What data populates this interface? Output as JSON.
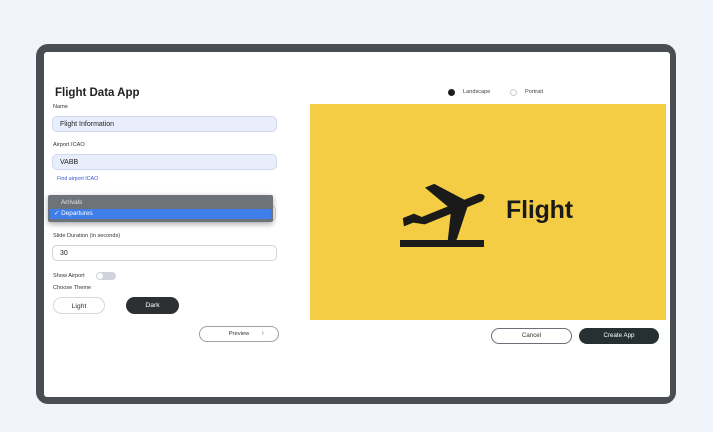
{
  "app": {
    "title": "Flight Data App"
  },
  "form": {
    "name_label": "Name",
    "name_value": "Flight Information",
    "icao_label": "Airport ICAO",
    "icao_value": "VABB",
    "find_link": "Find airport ICAO",
    "type_options": [
      "Arrivals",
      "Departures"
    ],
    "type_selected": "✓ Departures",
    "duration_label": "Slide Duration (in seconds)",
    "duration_value": "30",
    "show_airport_label": "Show Airport",
    "show_airport_on": false,
    "theme_label": "Choose Theme",
    "theme_light": "Light",
    "theme_dark": "Dark",
    "preview_button": "Preview"
  },
  "orientation": {
    "landscape": "Landscape",
    "portrait": "Portrait",
    "selected": "Landscape"
  },
  "preview": {
    "title": "Flight",
    "background": "#f4cd44",
    "icon": "departure-plane-icon"
  },
  "actions": {
    "cancel": "Cancel",
    "create": "Create App"
  },
  "colors": {
    "accent_dark": "#263032",
    "selection": "#3f7ee8",
    "link": "#3a55d6"
  }
}
